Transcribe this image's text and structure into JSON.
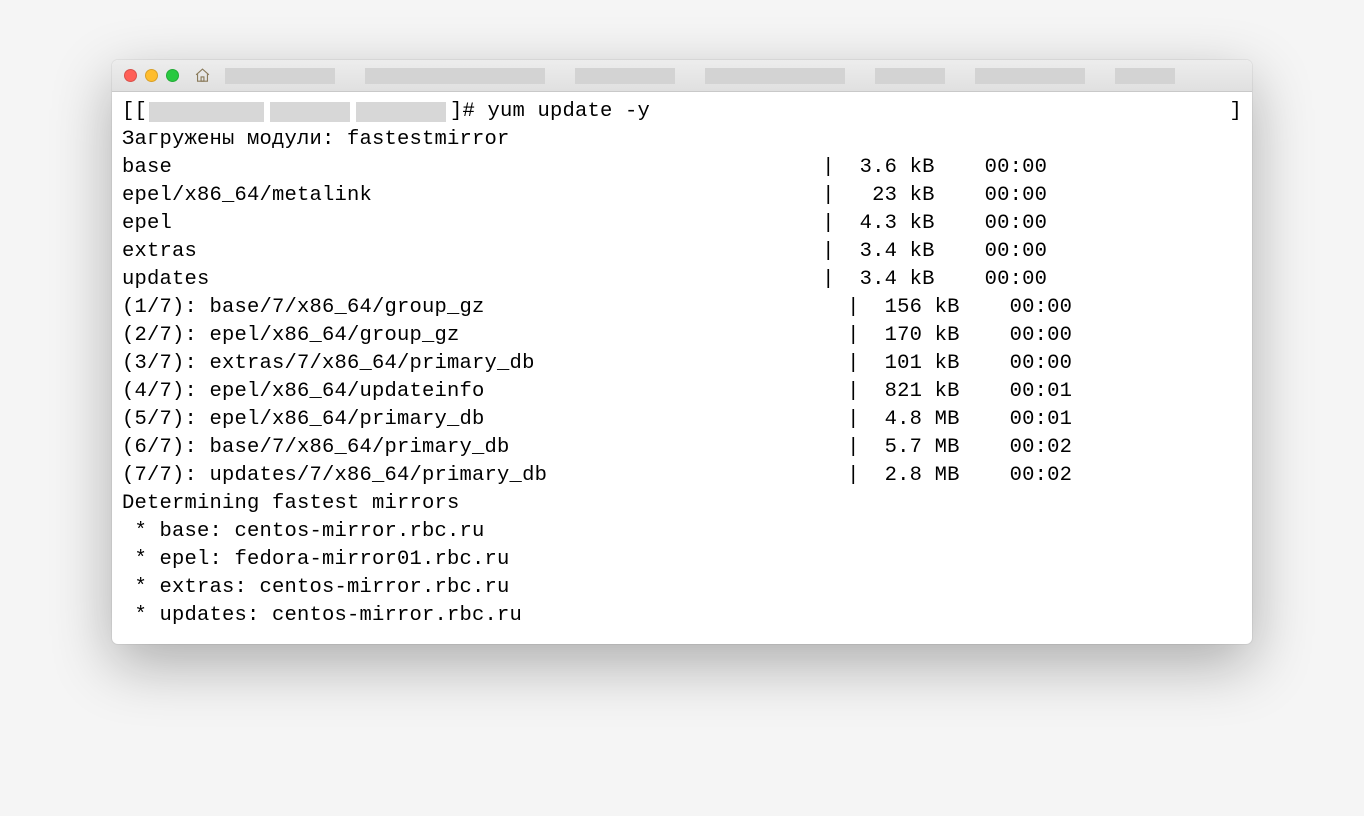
{
  "prompt": {
    "prefix_bracket": "[[",
    "suffix": "]# yum update -y",
    "trailing_bracket": "]"
  },
  "modules_line": "Загружены модули: fastestmirror",
  "repo_rows": [
    {
      "name": "base",
      "size": "3.6 kB",
      "time": "00:00"
    },
    {
      "name": "epel/x86_64/metalink",
      "size": " 23 kB",
      "time": "00:00"
    },
    {
      "name": "epel",
      "size": "4.3 kB",
      "time": "00:00"
    },
    {
      "name": "extras",
      "size": "3.4 kB",
      "time": "00:00"
    },
    {
      "name": "updates",
      "size": "3.4 kB",
      "time": "00:00"
    }
  ],
  "download_rows": [
    {
      "idx": "(1/7)",
      "name": "base/7/x86_64/group_gz",
      "size": "156 kB",
      "time": "00:00"
    },
    {
      "idx": "(2/7)",
      "name": "epel/x86_64/group_gz",
      "size": "170 kB",
      "time": "00:00"
    },
    {
      "idx": "(3/7)",
      "name": "extras/7/x86_64/primary_db",
      "size": "101 kB",
      "time": "00:00"
    },
    {
      "idx": "(4/7)",
      "name": "epel/x86_64/updateinfo",
      "size": "821 kB",
      "time": "00:01"
    },
    {
      "idx": "(5/7)",
      "name": "epel/x86_64/primary_db",
      "size": "4.8 MB",
      "time": "00:01"
    },
    {
      "idx": "(6/7)",
      "name": "base/7/x86_64/primary_db",
      "size": "5.7 MB",
      "time": "00:02"
    },
    {
      "idx": "(7/7)",
      "name": "updates/7/x86_64/primary_db",
      "size": "2.8 MB",
      "time": "00:02"
    }
  ],
  "determining": "Determining fastest mirrors",
  "mirrors": [
    " * base: centos-mirror.rbc.ru",
    " * epel: fedora-mirror01.rbc.ru",
    " * extras: centos-mirror.rbc.ru",
    " * updates: centos-mirror.rbc.ru"
  ],
  "col_name_width": 56,
  "col_size_width": 7,
  "col_time_width": 9,
  "col_name_width_dl": 58,
  "col_size_width_dl": 7,
  "cursor_col": 90
}
